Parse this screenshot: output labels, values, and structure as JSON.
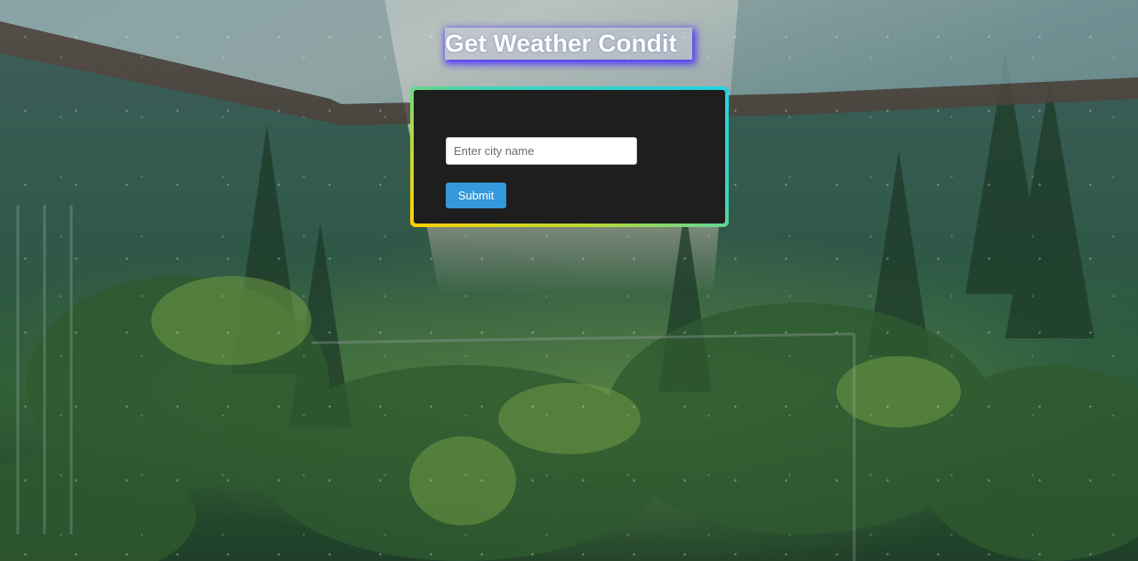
{
  "page": {
    "title": "Get Weather Condit"
  },
  "form": {
    "city_placeholder": "Enter city name",
    "city_value": "",
    "submit_label": "Submit"
  },
  "colors": {
    "card_background": "#1e1e1e",
    "border_gradient": [
      "#ffd000",
      "#b7d93a",
      "#3fd4b8",
      "#22d3e6"
    ],
    "submit_button": "#3498db",
    "title_glow": "#4628ff"
  }
}
